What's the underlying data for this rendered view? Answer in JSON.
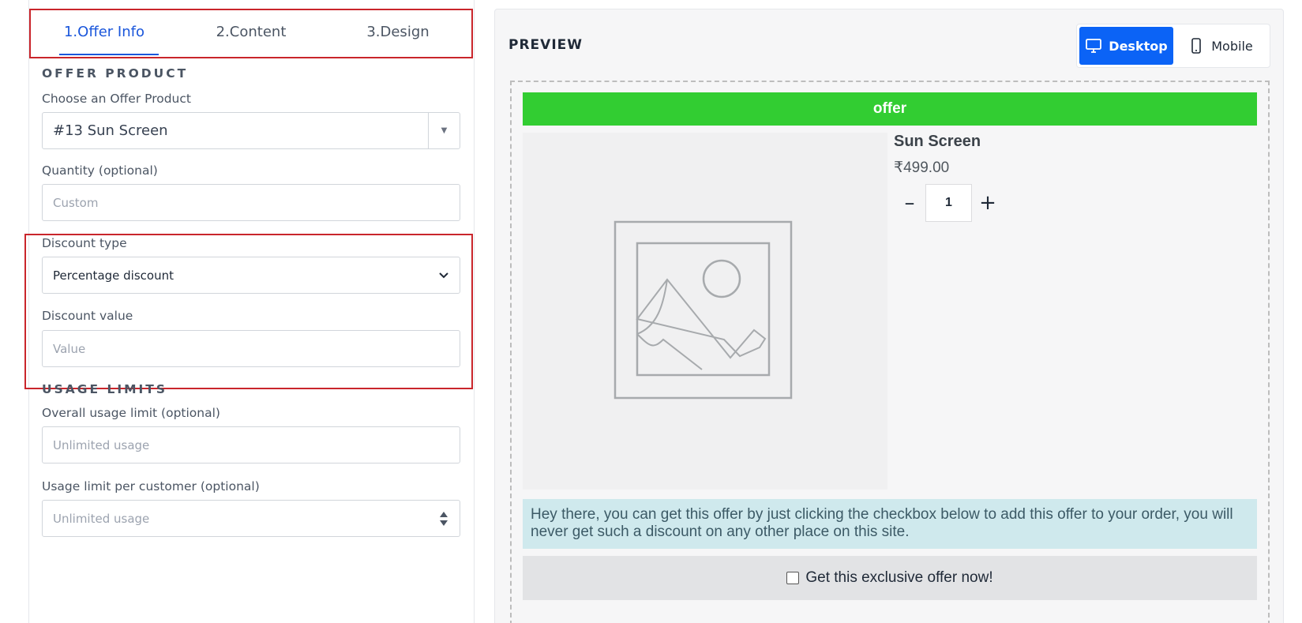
{
  "tabs": [
    "1.Offer Info",
    "2.Content",
    "3.Design"
  ],
  "offer_product": {
    "section_title": "OFFER PRODUCT",
    "choose_label": "Choose an Offer Product",
    "selected_product": "#13 Sun Screen",
    "quantity_label": "Quantity (optional)",
    "quantity_placeholder": "Custom"
  },
  "discount": {
    "type_label": "Discount type",
    "type_value": "Percentage discount",
    "value_label": "Discount value",
    "value_placeholder": "Value"
  },
  "usage_limits": {
    "section_title": "USAGE LIMITS",
    "overall_label": "Overall usage limit (optional)",
    "overall_placeholder": "Unlimited usage",
    "per_customer_label": "Usage limit per customer (optional)",
    "per_customer_placeholder": "Unlimited usage"
  },
  "preview": {
    "title": "PREVIEW",
    "desktop_label": "Desktop",
    "mobile_label": "Mobile",
    "offer_banner": "offer",
    "product_name": "Sun Screen",
    "price": "₹499.00",
    "quantity": "1",
    "minus": "–",
    "plus": "+",
    "message": "Hey there, you can get this offer by just clicking the checkbox below to add this offer to your order, you will never get such a discount on any other place on this site.",
    "cta_label": "Get this exclusive offer now!"
  },
  "colors": {
    "accent": "#1a56db",
    "highlight_border": "#c9252b",
    "offer_banner": "#32cd32",
    "message_bg": "#cfe9ed",
    "cta_bg": "#e2e3e5"
  }
}
